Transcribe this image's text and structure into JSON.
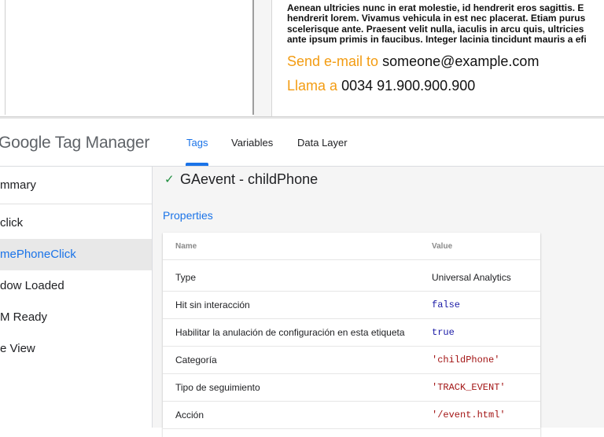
{
  "preview": {
    "lorem_lines": [
      "Aenean ultricies nunc in erat molestie, id hendrerit eros sagittis. E",
      "hendrerit lorem. Vivamus vehicula in est nec placerat. Etiam purus",
      "scelerisque ante. Praesent velit nulla, iaculis in arcu quis, ultricies",
      "ante ipsum primis in faucibus. Integer lacinia tincidunt mauris a efi"
    ],
    "email_label": "Send e-mail to",
    "email_value": "someone@example.com",
    "phone_label": "Llama a",
    "phone_value": "0034 91.900.900.900"
  },
  "header": {
    "logo": "Google Tag Manager",
    "tabs": [
      "Tags",
      "Variables",
      "Data Layer"
    ],
    "active_tab": "Tags"
  },
  "sidebar": {
    "items": [
      {
        "label": "mmary"
      },
      {
        "label": "click"
      },
      {
        "label": "mePhoneClick"
      },
      {
        "label": "dow Loaded"
      },
      {
        "label": "M Ready"
      },
      {
        "label": "e View"
      }
    ],
    "active_index": 2
  },
  "main": {
    "tag_title": "GAevent - childPhone",
    "properties_title": "Properties",
    "table": {
      "headers": {
        "name": "Name",
        "value": "Value"
      },
      "rows": [
        {
          "name": "Type",
          "value": "Universal Analytics"
        },
        {
          "name": "Hit sin interacción",
          "value": "false"
        },
        {
          "name": "Habilitar la anulación de configuración en esta etiqueta",
          "value": "true"
        },
        {
          "name": "Categoría",
          "value": "'childPhone'"
        },
        {
          "name": "Tipo de seguimiento",
          "value": "'TRACK_EVENT'"
        },
        {
          "name": "Acción",
          "value": "'/event.html'"
        }
      ]
    }
  },
  "colors": {
    "accent": "#1a73e8",
    "orange": "#f39c12",
    "success": "#1e8e3e",
    "string": "#a31515",
    "keyword": "#1a1aa6"
  },
  "icons": {
    "status": "check-icon"
  }
}
